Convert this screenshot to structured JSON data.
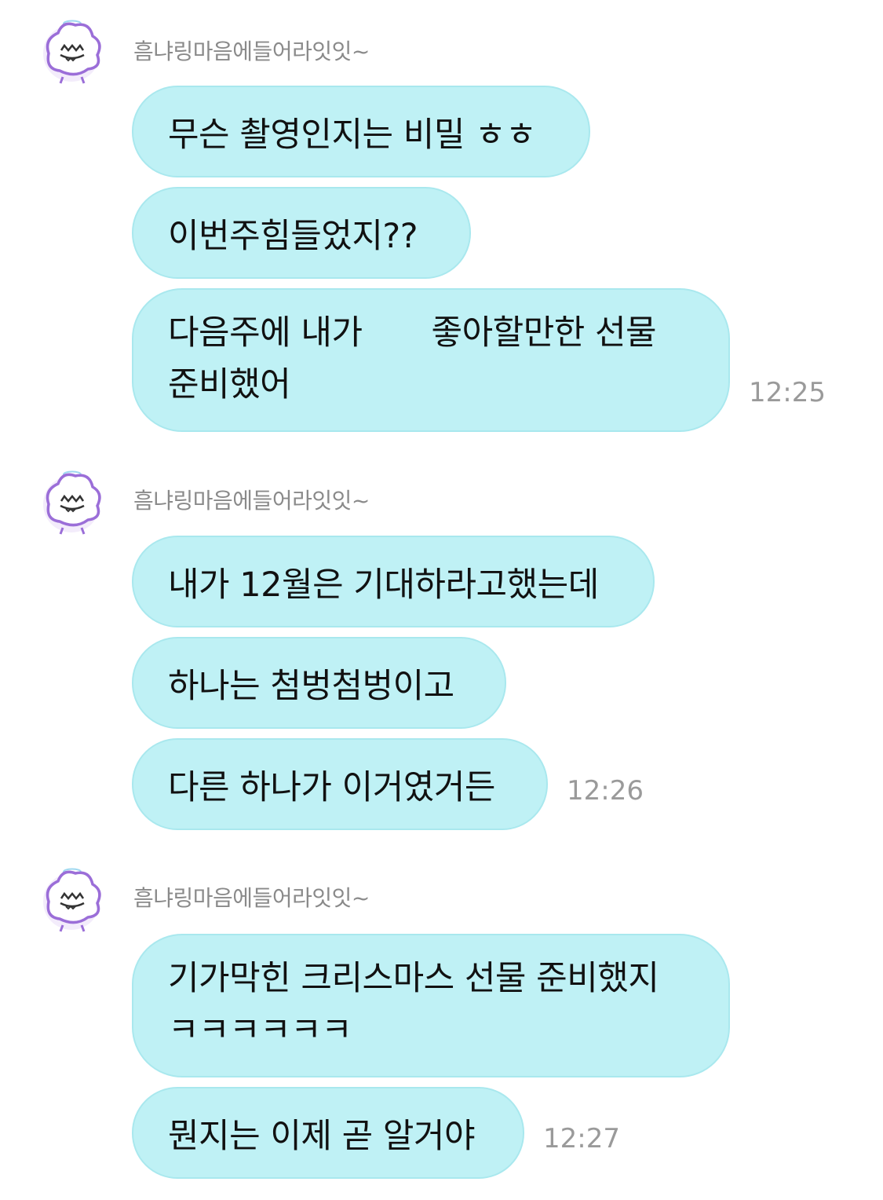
{
  "groups": [
    {
      "sender": "흠냐링마음에들어라잇잇~",
      "messages": [
        {
          "lines": [
            "무슨 촬영인지는 비밀 ㅎㅎ"
          ]
        },
        {
          "lines": [
            "이번주힘들었지??"
          ]
        },
        {
          "lines": [
            "다음주에 내가",
            "좋아할만한 선물",
            "준비했어"
          ]
        }
      ],
      "time": "12:25"
    },
    {
      "sender": "흠냐링마음에들어라잇잇~",
      "messages": [
        {
          "lines": [
            "내가 12월은 기대하라고했는데"
          ]
        },
        {
          "lines": [
            "하나는 첨벙첨벙이고"
          ]
        },
        {
          "lines": [
            "다른 하나가 이거였거든"
          ]
        }
      ],
      "time": "12:26"
    },
    {
      "sender": "흠냐링마음에들어라잇잇~",
      "messages": [
        {
          "lines": [
            "기가막힌 크리스마스 선물 준비했지",
            "ㅋㅋㅋㅋㅋㅋ"
          ]
        },
        {
          "lines": [
            "뭔지는 이제 곧 알거야"
          ]
        }
      ],
      "time": "12:27"
    }
  ],
  "colors": {
    "bubble": "#bff1f5",
    "bubble_border": "#a9e8ee",
    "avatar_accent": "#9b6ed8"
  },
  "icons": {
    "avatar": "halo-cloud-face-icon"
  }
}
